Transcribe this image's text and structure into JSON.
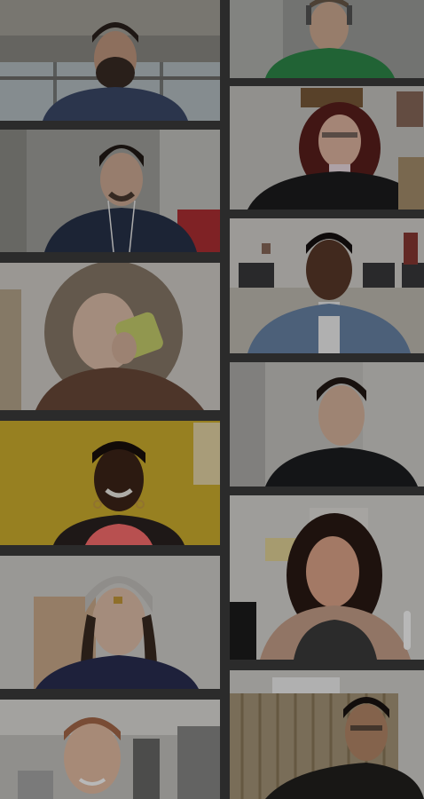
{
  "app": {
    "background_color": "#2b2b2b"
  },
  "gallery": {
    "participants": [
      {
        "id": 1,
        "icon": "video-tile-participant"
      },
      {
        "id": 2,
        "icon": "video-tile-participant"
      },
      {
        "id": 3,
        "icon": "video-tile-participant"
      },
      {
        "id": 4,
        "icon": "video-tile-participant"
      },
      {
        "id": 5,
        "icon": "video-tile-participant"
      },
      {
        "id": 6,
        "icon": "video-tile-participant"
      },
      {
        "id": 7,
        "icon": "video-tile-participant"
      },
      {
        "id": 8,
        "icon": "video-tile-participant"
      },
      {
        "id": 9,
        "icon": "video-tile-participant"
      },
      {
        "id": 10,
        "icon": "video-tile-participant"
      },
      {
        "id": 11,
        "icon": "video-tile-participant"
      },
      {
        "id": 12,
        "icon": "video-tile-participant"
      }
    ]
  }
}
